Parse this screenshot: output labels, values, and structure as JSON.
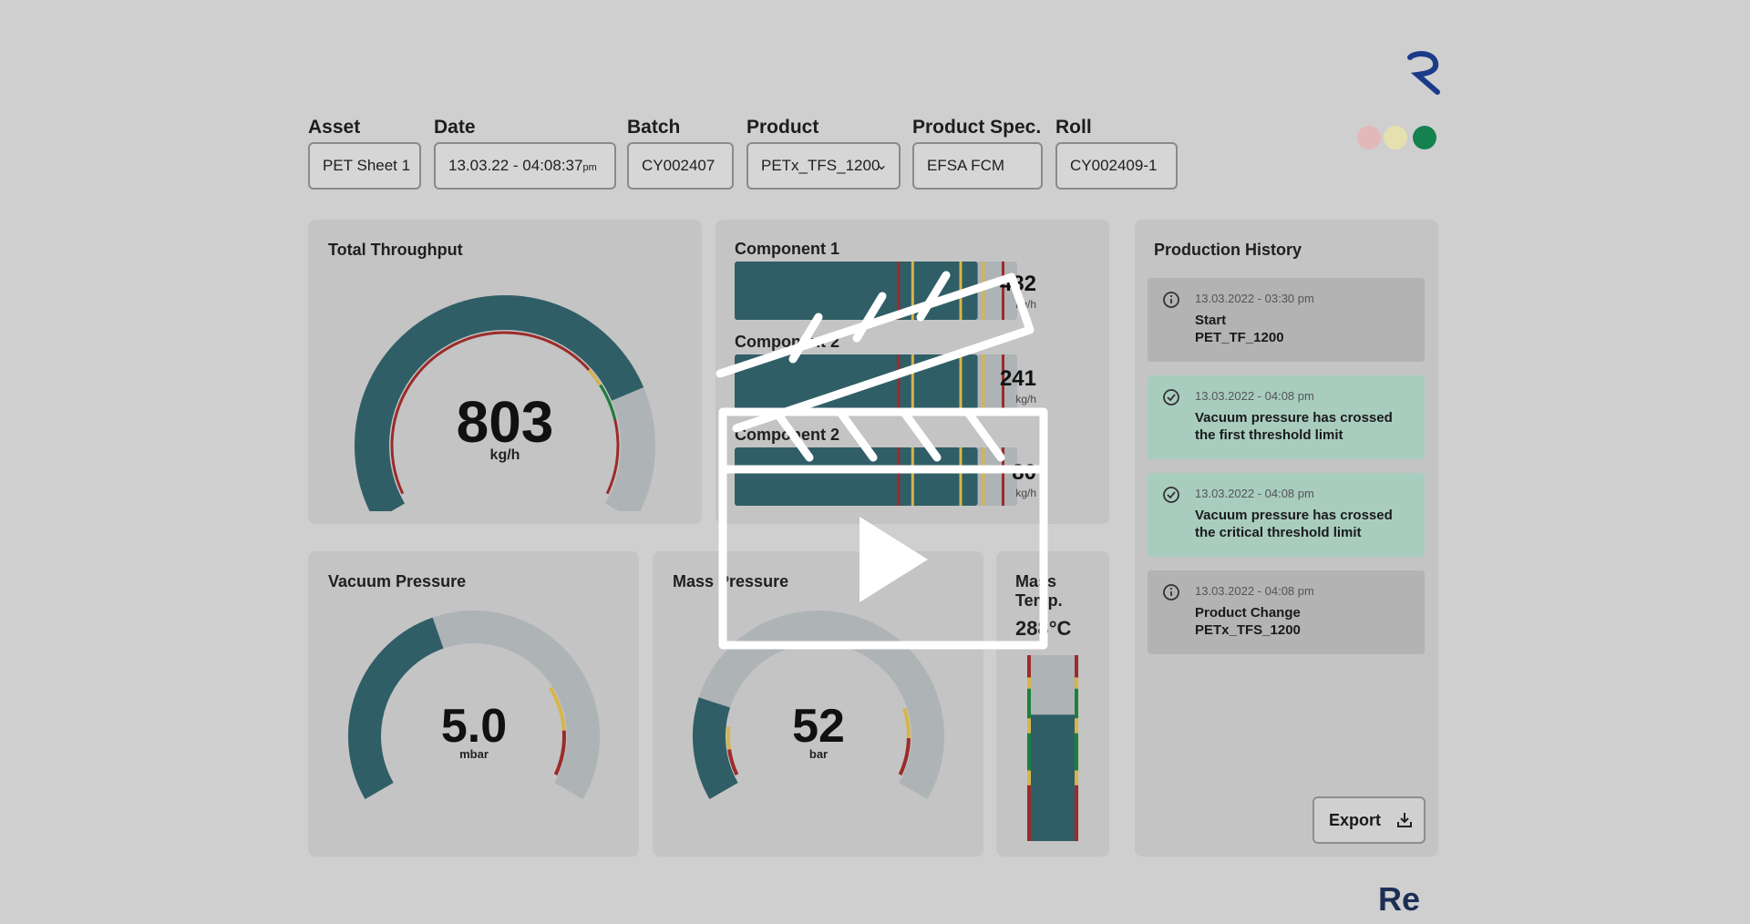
{
  "filters": [
    {
      "label": "Asset",
      "value": "PET Sheet 1"
    },
    {
      "label": "Date",
      "value": "13.03.22 - 04:08:37",
      "suffix": "pm"
    },
    {
      "label": "Batch",
      "value": "CY002407"
    },
    {
      "label": "Product",
      "value": "PETx_TFS_1200"
    },
    {
      "label": "Product Spec.",
      "value": "EFSA FCM"
    },
    {
      "label": "Roll",
      "value": "CY002409-1"
    }
  ],
  "status_lights": {
    "colors": [
      "#e2b8b8",
      "#e6e0b0",
      "#13824f"
    ],
    "active": "green"
  },
  "total_throughput": {
    "title": "Total Throughput",
    "value": "803",
    "unit": "kg/h",
    "level": 0.78
  },
  "components": [
    {
      "title": "Component 1",
      "value": "482",
      "unit": "kg/h",
      "fill": 0.86
    },
    {
      "title": "Component 2",
      "value": "241",
      "unit": "kg/h",
      "fill": 0.86
    },
    {
      "title": "Component 2",
      "value": "80",
      "unit": "kg/h",
      "fill": 0.86
    }
  ],
  "vacuum_pressure": {
    "title": "Vacuum Pressure",
    "value": "5.0",
    "unit": "mbar",
    "level": 0.42
  },
  "mass_pressure": {
    "title": "Mass Pressure",
    "value": "52",
    "unit": "bar",
    "level": 0.2
  },
  "mass_temp": {
    "title_line1": "Mass",
    "title_line2": "Temp.",
    "value": "288°C",
    "level": 0.68
  },
  "production_history": {
    "title": "Production History",
    "entries": [
      {
        "icon": "info-icon",
        "time": "13.03.2022 - 03:30 pm",
        "text_line1": "Start",
        "text_line2": "PET_TF_1200",
        "color": "#b3b3b3"
      },
      {
        "icon": "check-circle-icon",
        "time": "13.03.2022 - 04:08 pm",
        "text_line1": "Vacuum pressure has crossed",
        "text_line2": "the first threshold limit",
        "color": "#a8cdbf"
      },
      {
        "icon": "check-circle-icon",
        "time": "13.03.2022 - 04:08 pm",
        "text_line1": "Vacuum pressure has crossed",
        "text_line2": "the critical threshold limit",
        "color": "#a8cdbf"
      },
      {
        "icon": "info-icon",
        "time": "13.03.2022 - 04:08 pm",
        "text_line1": "Product Change",
        "text_line2": "PETx_TFS_1200",
        "color": "#b3b3b3"
      }
    ],
    "export_label": "Export"
  },
  "colors": {
    "gauge_fill": "#305e66",
    "gauge_track": "#aeb3b5",
    "threshold_red": "#9c2b2b",
    "threshold_yellow": "#d7b54a",
    "threshold_green": "#1d7f3e"
  }
}
